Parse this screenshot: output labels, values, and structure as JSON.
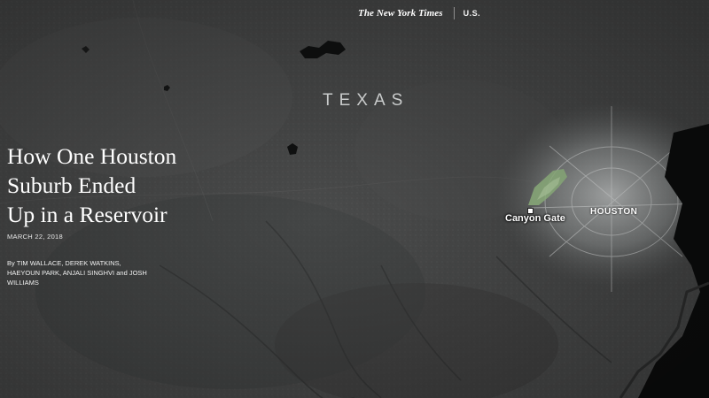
{
  "masthead": {
    "logo": "The New York Times",
    "section": "U.S."
  },
  "map": {
    "state_label": "TEXAS",
    "places": {
      "canyon_gate": "Canyon Gate",
      "houston": "HOUSTON"
    }
  },
  "article": {
    "headline_lines": [
      "How One Houston",
      "Suburb Ended",
      "Up in a Reservoir"
    ],
    "date": "MARCH 22, 2018",
    "byline": "By TIM WALLACE, DEREK WATKINS, HAEYOUN PARK, ANJALI SINGHVI and JOSH WILLIAMS"
  },
  "colors": {
    "land": "#4a4b4b",
    "water": "#0c0d0d",
    "urban": "#d8dada",
    "flooded_area": "#9fc58c",
    "text": "#ffffff"
  }
}
